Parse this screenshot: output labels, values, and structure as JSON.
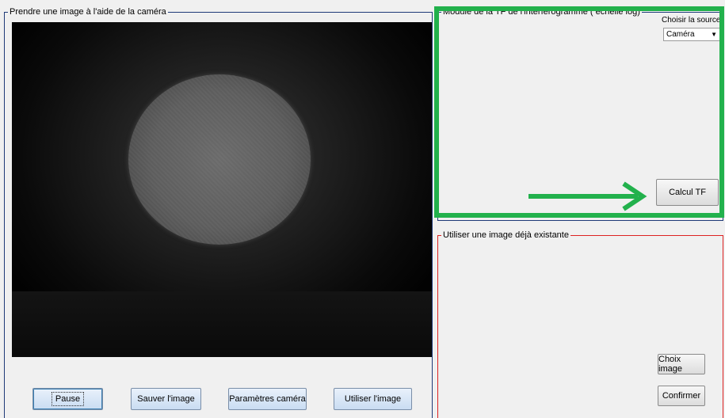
{
  "camera_panel": {
    "title": "Prendre une image à l'aide de la caméra",
    "buttons": {
      "pause": "Pause",
      "save": "Sauver l'image",
      "params": "Paramètres caméra",
      "use": "Utiliser l'image"
    }
  },
  "tf_panel": {
    "title": "Module de la TF de l'interférogramme ( échelle log)",
    "source_label": "Choisir la source",
    "source_value": "Caméra",
    "calc_button": "Calcul TF"
  },
  "existing_panel": {
    "title": "Utiliser une image déjà existante",
    "choose_button": "Choix image",
    "confirm_button": "Confirmer"
  },
  "annotations": {
    "highlight_color": "#22b14c",
    "arrow_icon": "right-arrow-icon"
  },
  "colors": {
    "panel_border_blue": "#1f3a78",
    "panel_border_red": "#d22222"
  }
}
